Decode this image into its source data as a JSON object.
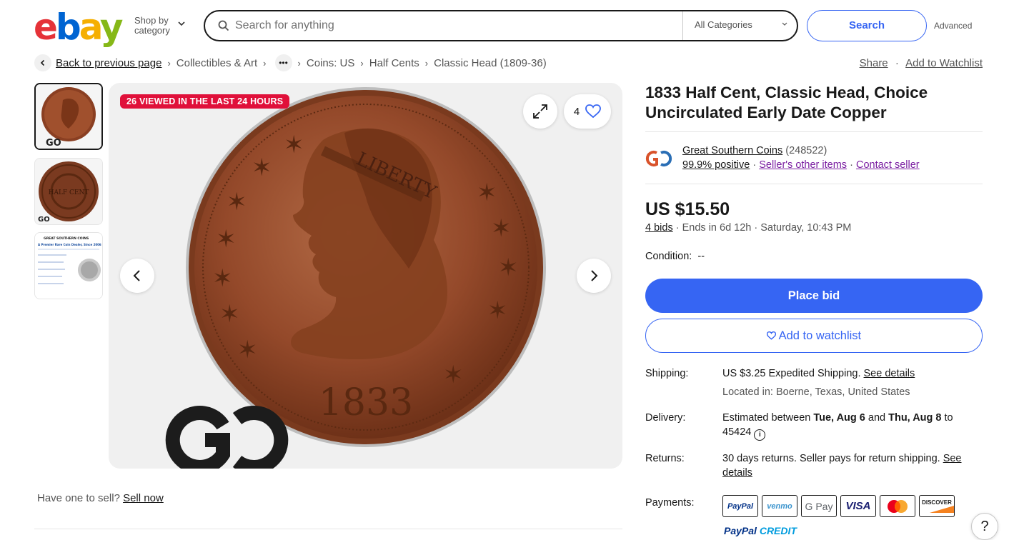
{
  "header": {
    "logo": {
      "e": "e",
      "b": "b",
      "a": "a",
      "y": "y"
    },
    "shop_by_line1": "Shop by",
    "shop_by_line2": "category",
    "search_placeholder": "Search for anything",
    "category_select": "All Categories",
    "search_button": "Search",
    "advanced_link": "Advanced"
  },
  "breadcrumb": {
    "back": "Back to previous page",
    "items": [
      "Collectibles & Art",
      "Coins: US",
      "Half Cents",
      "Classic Head (1809-36)"
    ],
    "share": "Share",
    "add_watchlist": "Add to Watchlist"
  },
  "gallery": {
    "viewed_badge": "26 VIEWED IN THE LAST 24 HOURS",
    "watch_count": "4",
    "thumb3_brand": "GREAT SOUTHERN COINS",
    "thumb3_heading": "A Premier Rare Coin Dealer, Since 2006",
    "coin_year": "1833",
    "coin_legend": "LIBERTY",
    "thumb2_legend": "HALF CENT"
  },
  "sell": {
    "prompt": "Have one to sell?",
    "link": "Sell now"
  },
  "listing": {
    "title": "1833 Half Cent, Classic Head, Choice Uncirculated Early Date Copper",
    "seller": {
      "name": "Great Southern Coins",
      "count": "(248522)",
      "positive": "99.9% positive",
      "other_items": "Seller's other items",
      "contact": "Contact seller"
    },
    "price": "US $15.50",
    "bids": "4 bids",
    "ends": "Ends in 6d 12h · Saturday, 10:43 PM",
    "condition_label": "Condition:",
    "condition_value": "--",
    "place_bid": "Place bid",
    "add_watchlist": "Add to watchlist",
    "shipping_label": "Shipping:",
    "shipping_value": "US $3.25 Expedited Shipping.",
    "shipping_link": "See details",
    "located": "Located in: Boerne, Texas, United States",
    "delivery_label": "Delivery:",
    "delivery_pre": "Estimated between ",
    "delivery_d1": "Tue, Aug 6",
    "delivery_and": " and ",
    "delivery_d2": "Thu, Aug 8",
    "delivery_post": " to",
    "delivery_zip": "45424",
    "returns_label": "Returns:",
    "returns_value": "30 days returns. Seller pays for return shipping.",
    "returns_link_1": "See",
    "returns_link_2": "details",
    "payments_label": "Payments:",
    "payments": [
      "PayPal",
      "venmo",
      "G Pay",
      "VISA",
      "Mastercard",
      "DISCOVER"
    ],
    "paypal_credit_1": "PayPal",
    "paypal_credit_2": "CREDIT"
  },
  "help": "?",
  "colors": {
    "accent": "#3665f3",
    "badge_red": "#e0103a",
    "link_purple": "#7b1fa2"
  }
}
